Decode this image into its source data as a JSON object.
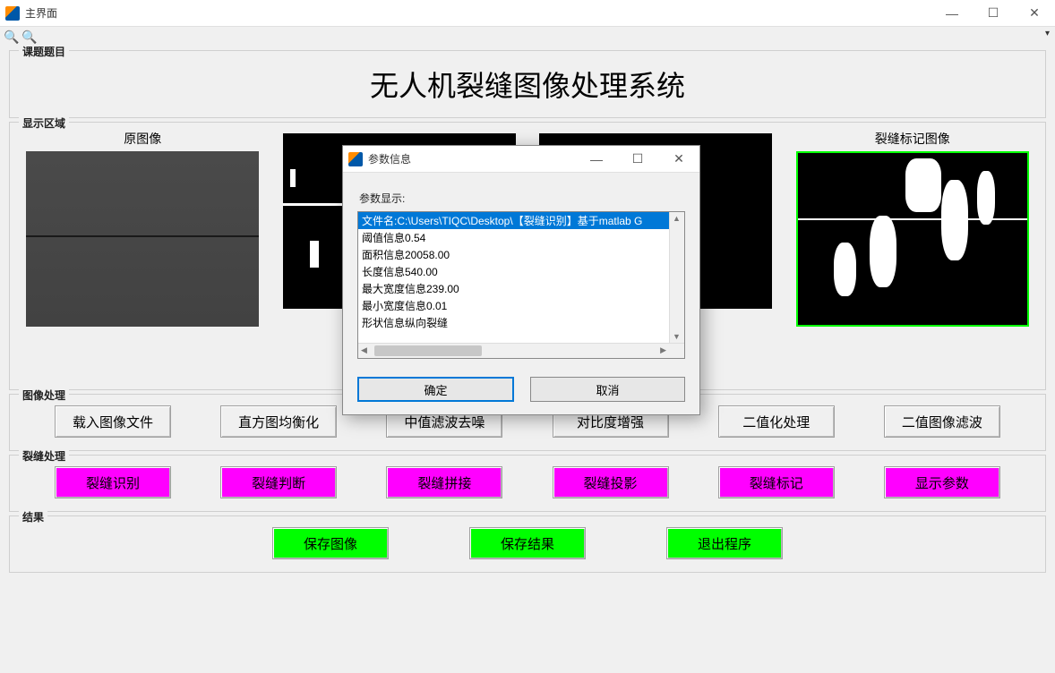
{
  "window": {
    "title": "主界面",
    "controls": {
      "minimize": "—",
      "maximize": "☐",
      "close": "✕"
    }
  },
  "toolbar": {
    "zoom_in": "🔍+",
    "zoom_out": "🔍−"
  },
  "groups": {
    "topic": "课题题目",
    "display": "显示区域",
    "img_proc": "图像处理",
    "crack_proc": "裂缝处理",
    "result": "结果"
  },
  "app_title": "无人机裂缝图像处理系统",
  "display_labels": {
    "original": "原图像",
    "mid1": "",
    "mid2": "",
    "marked": "裂缝标记图像"
  },
  "img_proc_buttons": [
    "载入图像文件",
    "直方图均衡化",
    "中值滤波去噪",
    "对比度增强",
    "二值化处理",
    "二值图像滤波"
  ],
  "crack_proc_buttons": [
    "裂缝识别",
    "裂缝判断",
    "裂缝拼接",
    "裂缝投影",
    "裂缝标记",
    "显示参数"
  ],
  "result_buttons": [
    "保存图像",
    "保存结果",
    "退出程序"
  ],
  "dialog": {
    "title": "参数信息",
    "label": "参数显示:",
    "rows": [
      "文件名:C:\\Users\\TIQC\\Desktop\\【裂缝识别】基于matlab G",
      "阈值信息0.54",
      "面积信息20058.00",
      "长度信息540.00",
      "最大宽度信息239.00",
      "最小宽度信息0.01",
      "形状信息纵向裂缝"
    ],
    "ok": "确定",
    "cancel": "取消"
  }
}
